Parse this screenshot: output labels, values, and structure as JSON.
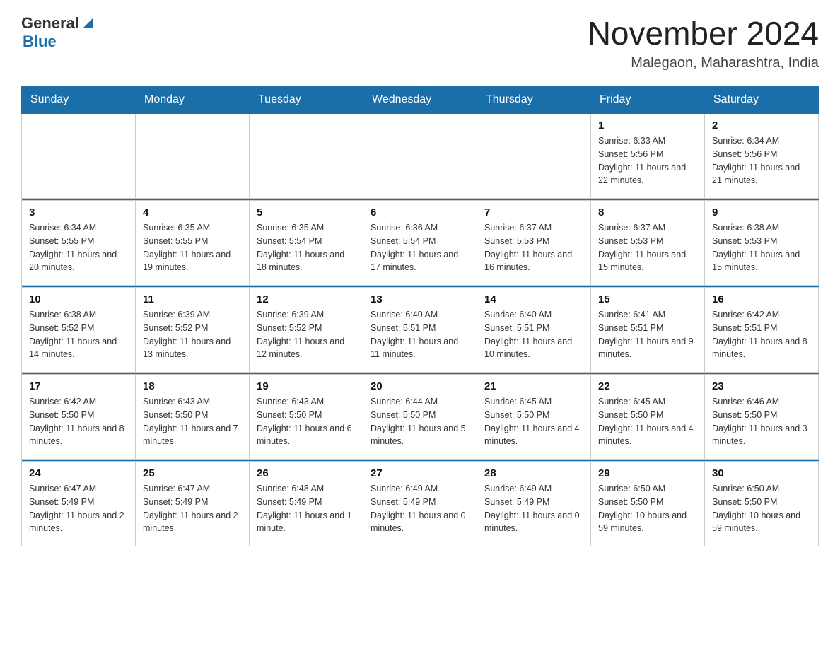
{
  "header": {
    "logo_general": "General",
    "logo_blue": "Blue",
    "month_year": "November 2024",
    "location": "Malegaon, Maharashtra, India"
  },
  "days_of_week": [
    "Sunday",
    "Monday",
    "Tuesday",
    "Wednesday",
    "Thursday",
    "Friday",
    "Saturday"
  ],
  "weeks": [
    {
      "days": [
        {
          "date": "",
          "info": ""
        },
        {
          "date": "",
          "info": ""
        },
        {
          "date": "",
          "info": ""
        },
        {
          "date": "",
          "info": ""
        },
        {
          "date": "",
          "info": ""
        },
        {
          "date": "1",
          "info": "Sunrise: 6:33 AM\nSunset: 5:56 PM\nDaylight: 11 hours and 22 minutes."
        },
        {
          "date": "2",
          "info": "Sunrise: 6:34 AM\nSunset: 5:56 PM\nDaylight: 11 hours and 21 minutes."
        }
      ]
    },
    {
      "days": [
        {
          "date": "3",
          "info": "Sunrise: 6:34 AM\nSunset: 5:55 PM\nDaylight: 11 hours and 20 minutes."
        },
        {
          "date": "4",
          "info": "Sunrise: 6:35 AM\nSunset: 5:55 PM\nDaylight: 11 hours and 19 minutes."
        },
        {
          "date": "5",
          "info": "Sunrise: 6:35 AM\nSunset: 5:54 PM\nDaylight: 11 hours and 18 minutes."
        },
        {
          "date": "6",
          "info": "Sunrise: 6:36 AM\nSunset: 5:54 PM\nDaylight: 11 hours and 17 minutes."
        },
        {
          "date": "7",
          "info": "Sunrise: 6:37 AM\nSunset: 5:53 PM\nDaylight: 11 hours and 16 minutes."
        },
        {
          "date": "8",
          "info": "Sunrise: 6:37 AM\nSunset: 5:53 PM\nDaylight: 11 hours and 15 minutes."
        },
        {
          "date": "9",
          "info": "Sunrise: 6:38 AM\nSunset: 5:53 PM\nDaylight: 11 hours and 15 minutes."
        }
      ]
    },
    {
      "days": [
        {
          "date": "10",
          "info": "Sunrise: 6:38 AM\nSunset: 5:52 PM\nDaylight: 11 hours and 14 minutes."
        },
        {
          "date": "11",
          "info": "Sunrise: 6:39 AM\nSunset: 5:52 PM\nDaylight: 11 hours and 13 minutes."
        },
        {
          "date": "12",
          "info": "Sunrise: 6:39 AM\nSunset: 5:52 PM\nDaylight: 11 hours and 12 minutes."
        },
        {
          "date": "13",
          "info": "Sunrise: 6:40 AM\nSunset: 5:51 PM\nDaylight: 11 hours and 11 minutes."
        },
        {
          "date": "14",
          "info": "Sunrise: 6:40 AM\nSunset: 5:51 PM\nDaylight: 11 hours and 10 minutes."
        },
        {
          "date": "15",
          "info": "Sunrise: 6:41 AM\nSunset: 5:51 PM\nDaylight: 11 hours and 9 minutes."
        },
        {
          "date": "16",
          "info": "Sunrise: 6:42 AM\nSunset: 5:51 PM\nDaylight: 11 hours and 8 minutes."
        }
      ]
    },
    {
      "days": [
        {
          "date": "17",
          "info": "Sunrise: 6:42 AM\nSunset: 5:50 PM\nDaylight: 11 hours and 8 minutes."
        },
        {
          "date": "18",
          "info": "Sunrise: 6:43 AM\nSunset: 5:50 PM\nDaylight: 11 hours and 7 minutes."
        },
        {
          "date": "19",
          "info": "Sunrise: 6:43 AM\nSunset: 5:50 PM\nDaylight: 11 hours and 6 minutes."
        },
        {
          "date": "20",
          "info": "Sunrise: 6:44 AM\nSunset: 5:50 PM\nDaylight: 11 hours and 5 minutes."
        },
        {
          "date": "21",
          "info": "Sunrise: 6:45 AM\nSunset: 5:50 PM\nDaylight: 11 hours and 4 minutes."
        },
        {
          "date": "22",
          "info": "Sunrise: 6:45 AM\nSunset: 5:50 PM\nDaylight: 11 hours and 4 minutes."
        },
        {
          "date": "23",
          "info": "Sunrise: 6:46 AM\nSunset: 5:50 PM\nDaylight: 11 hours and 3 minutes."
        }
      ]
    },
    {
      "days": [
        {
          "date": "24",
          "info": "Sunrise: 6:47 AM\nSunset: 5:49 PM\nDaylight: 11 hours and 2 minutes."
        },
        {
          "date": "25",
          "info": "Sunrise: 6:47 AM\nSunset: 5:49 PM\nDaylight: 11 hours and 2 minutes."
        },
        {
          "date": "26",
          "info": "Sunrise: 6:48 AM\nSunset: 5:49 PM\nDaylight: 11 hours and 1 minute."
        },
        {
          "date": "27",
          "info": "Sunrise: 6:49 AM\nSunset: 5:49 PM\nDaylight: 11 hours and 0 minutes."
        },
        {
          "date": "28",
          "info": "Sunrise: 6:49 AM\nSunset: 5:49 PM\nDaylight: 11 hours and 0 minutes."
        },
        {
          "date": "29",
          "info": "Sunrise: 6:50 AM\nSunset: 5:50 PM\nDaylight: 10 hours and 59 minutes."
        },
        {
          "date": "30",
          "info": "Sunrise: 6:50 AM\nSunset: 5:50 PM\nDaylight: 10 hours and 59 minutes."
        }
      ]
    }
  ]
}
